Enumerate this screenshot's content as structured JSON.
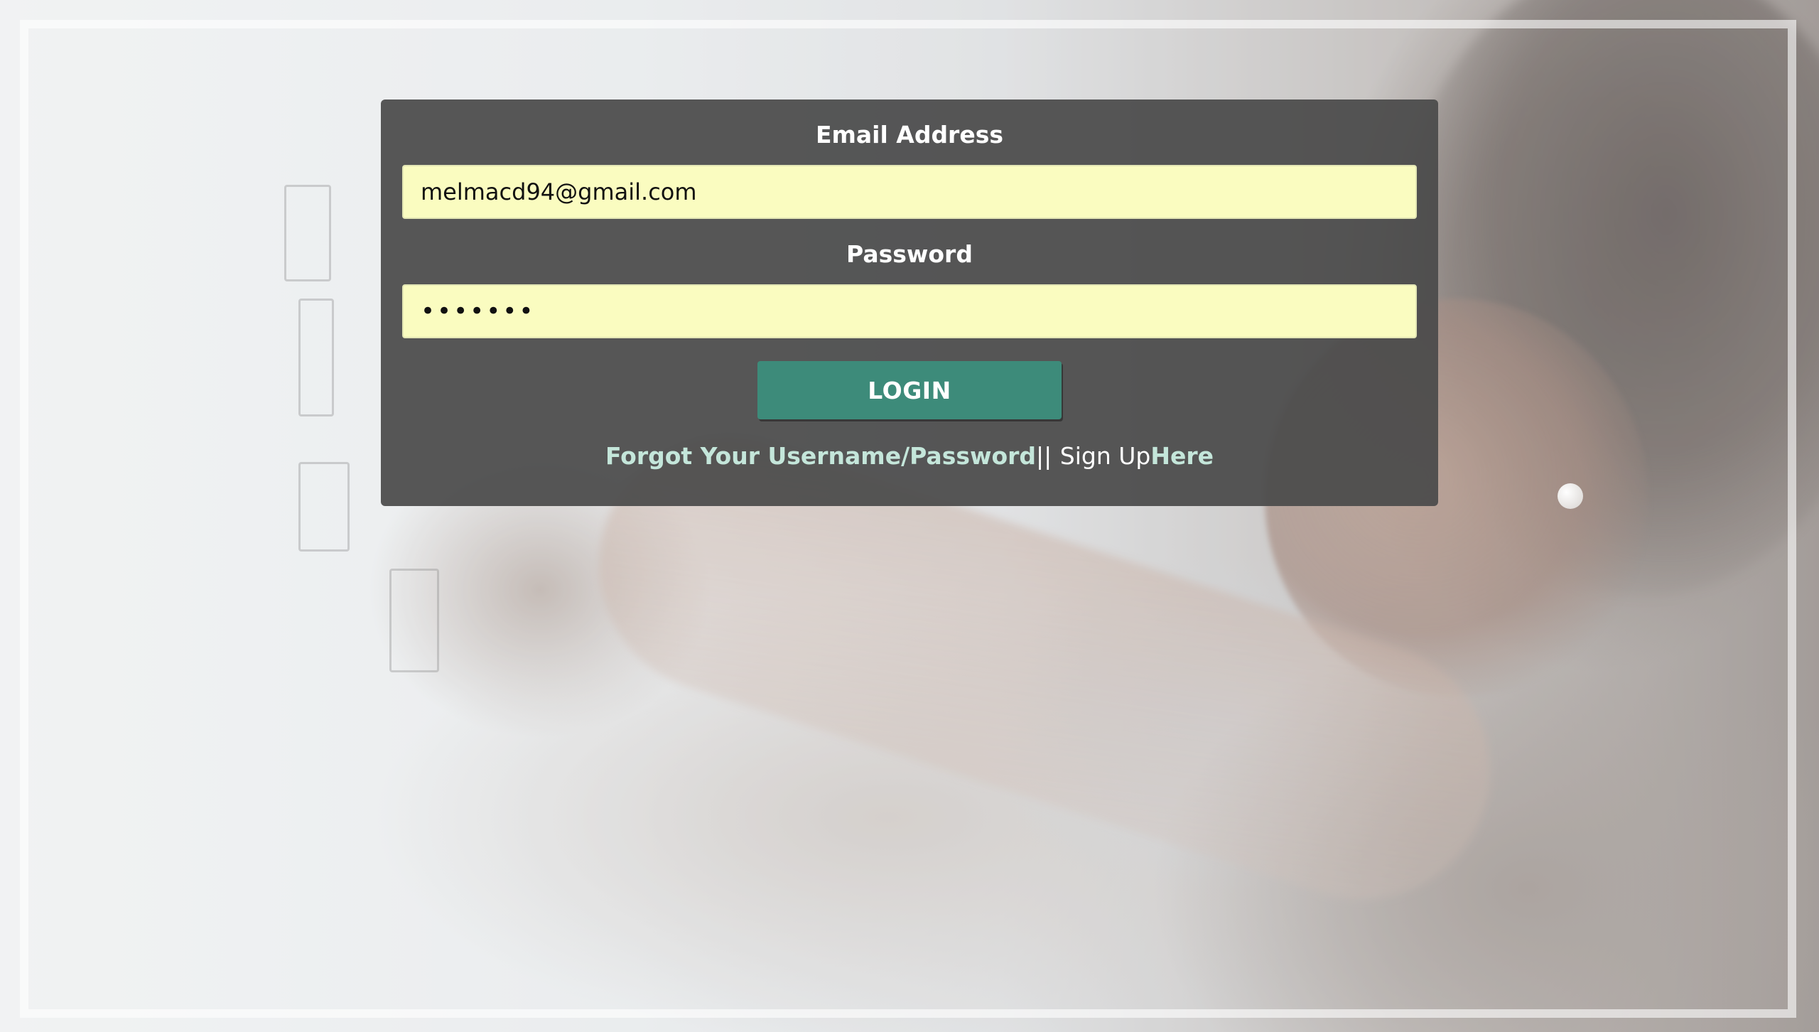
{
  "login_form": {
    "email_label": "Email Address",
    "email_value": "melmacd94@gmail.com",
    "password_label": "Password",
    "password_value": "•••••••",
    "login_button": "LOGIN",
    "forgot_link": "Forgot Your Username/Password",
    "separator": "||",
    "signup_text": "Sign Up",
    "signup_link": "Here"
  },
  "colors": {
    "panel_bg": "#4a4a4a",
    "input_bg": "#fafcc0",
    "button_bg": "#3d8b7a",
    "link_color": "#c4e6da"
  }
}
